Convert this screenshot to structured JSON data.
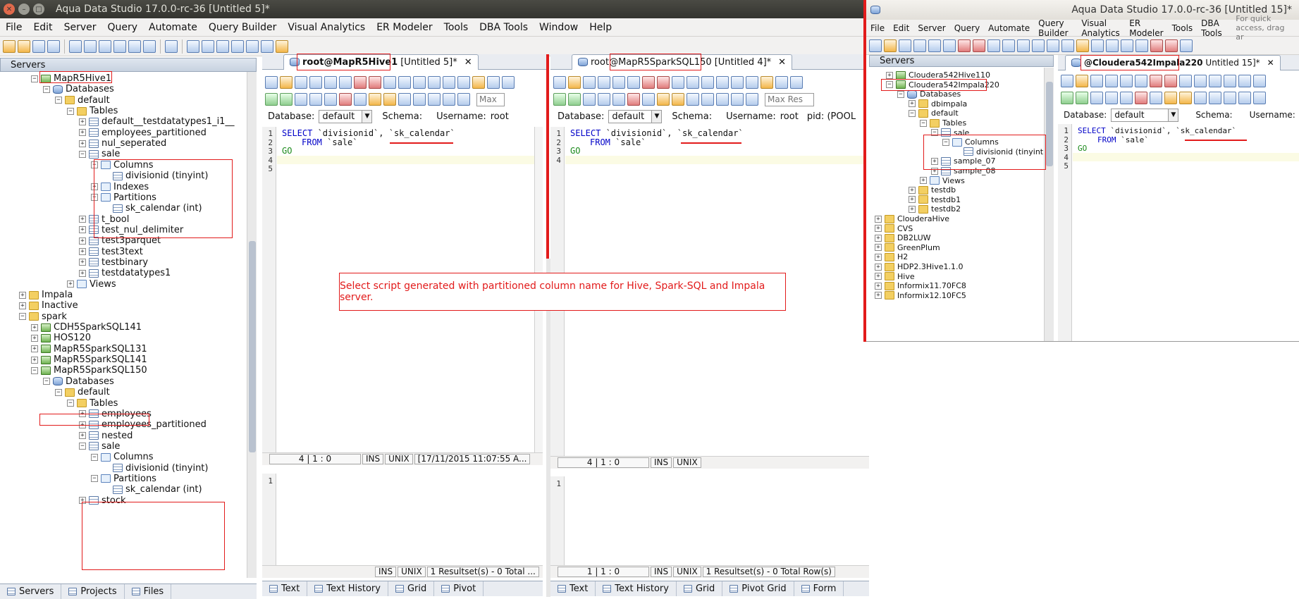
{
  "left_window": {
    "title": "Aqua Data Studio 17.0.0-rc-36 [Untitled 5]*",
    "menu": [
      "File",
      "Edit",
      "Server",
      "Query",
      "Automate",
      "Query Builder",
      "Visual Analytics",
      "ER Modeler",
      "Tools",
      "DBA Tools",
      "Window",
      "Help"
    ],
    "servers_panel_title": "Servers",
    "tree": [
      {
        "label": "MapR5Hive1",
        "icon": "server-connected",
        "level": 2,
        "exp": "-"
      },
      {
        "label": "Databases",
        "icon": "database",
        "level": 3,
        "exp": "-"
      },
      {
        "label": "default",
        "icon": "folder",
        "level": 4,
        "exp": "-"
      },
      {
        "label": "Tables",
        "icon": "folder",
        "level": 5,
        "exp": "-"
      },
      {
        "label": "default__testdatatypes1_i1__",
        "icon": "table",
        "level": 6,
        "exp": "+"
      },
      {
        "label": "employees_partitioned",
        "icon": "table",
        "level": 6,
        "exp": "+"
      },
      {
        "label": "nul_seperated",
        "icon": "table",
        "level": 6,
        "exp": "+"
      },
      {
        "label": "sale",
        "icon": "table",
        "level": 6,
        "exp": "-"
      },
      {
        "label": "Columns",
        "icon": "folder-blue",
        "level": 7,
        "exp": "-"
      },
      {
        "label": "divisionid (tinyint)",
        "icon": "table",
        "level": 8,
        "exp": ""
      },
      {
        "label": "Indexes",
        "icon": "folder-blue",
        "level": 7,
        "exp": "+"
      },
      {
        "label": "Partitions",
        "icon": "folder-blue",
        "level": 7,
        "exp": "-"
      },
      {
        "label": "sk_calendar (int)",
        "icon": "table",
        "level": 8,
        "exp": ""
      },
      {
        "label": "t_bool",
        "icon": "table",
        "level": 6,
        "exp": "+"
      },
      {
        "label": "test_nul_delimiter",
        "icon": "table",
        "level": 6,
        "exp": "+"
      },
      {
        "label": "test3parquet",
        "icon": "table",
        "level": 6,
        "exp": "+"
      },
      {
        "label": "test3text",
        "icon": "table",
        "level": 6,
        "exp": "+"
      },
      {
        "label": "testbinary",
        "icon": "table",
        "level": 6,
        "exp": "+"
      },
      {
        "label": "testdatatypes1",
        "icon": "table",
        "level": 6,
        "exp": "+"
      },
      {
        "label": "Views",
        "icon": "folder-blue",
        "level": 5,
        "exp": "+"
      },
      {
        "label": "Impala",
        "icon": "folder",
        "level": 1,
        "exp": "+"
      },
      {
        "label": "Inactive",
        "icon": "folder",
        "level": 1,
        "exp": "+"
      },
      {
        "label": "spark",
        "icon": "folder",
        "level": 1,
        "exp": "-"
      },
      {
        "label": "CDH5SparkSQL141",
        "icon": "server-connected",
        "level": 2,
        "exp": "+"
      },
      {
        "label": "HOS120",
        "icon": "server-connected",
        "level": 2,
        "exp": "+"
      },
      {
        "label": "MapR5SparkSQL131",
        "icon": "server-connected",
        "level": 2,
        "exp": "+"
      },
      {
        "label": "MapR5SparkSQL141",
        "icon": "server-connected",
        "level": 2,
        "exp": "+"
      },
      {
        "label": "MapR5SparkSQL150",
        "icon": "server-connected",
        "level": 2,
        "exp": "-"
      },
      {
        "label": "Databases",
        "icon": "database",
        "level": 3,
        "exp": "-"
      },
      {
        "label": "default",
        "icon": "folder",
        "level": 4,
        "exp": "-"
      },
      {
        "label": "Tables",
        "icon": "folder",
        "level": 5,
        "exp": "-"
      },
      {
        "label": "employees",
        "icon": "table",
        "level": 6,
        "exp": "+"
      },
      {
        "label": "employees_partitioned",
        "icon": "table",
        "level": 6,
        "exp": "+"
      },
      {
        "label": "nested",
        "icon": "table",
        "level": 6,
        "exp": "+"
      },
      {
        "label": "sale",
        "icon": "table",
        "level": 6,
        "exp": "-"
      },
      {
        "label": "Columns",
        "icon": "folder-blue",
        "level": 7,
        "exp": "-"
      },
      {
        "label": "divisionid (tinyint)",
        "icon": "table",
        "level": 8,
        "exp": ""
      },
      {
        "label": "Partitions",
        "icon": "folder-blue",
        "level": 7,
        "exp": "-"
      },
      {
        "label": "sk_calendar (int)",
        "icon": "table",
        "level": 8,
        "exp": ""
      },
      {
        "label": "stock",
        "icon": "table",
        "level": 6,
        "exp": "+"
      }
    ],
    "bottom_tabs": [
      "Servers",
      "Projects",
      "Files"
    ],
    "editor1": {
      "tab_label_user": "root@MapR5Hive1",
      "tab_label_rest": "[Untitled 5]*",
      "database_label": "Database:",
      "database_value": "default",
      "schema_label": "Schema:",
      "username_label": "Username:",
      "username_value": "root",
      "max_results_placeholder": "Max",
      "lines": [
        "1",
        "2",
        "3",
        "4",
        "5"
      ],
      "code": {
        "select_kw": "SELECT",
        "select_cols": " `divisionid`, `sk_calendar`",
        "from_kw": "FROM",
        "from_tbl": " `sale`",
        "go": "GO"
      },
      "status": {
        "pos": "4 | 1 : 0",
        "ins": "INS",
        "unix": "UNIX",
        "time": "[17/11/2015 11:07:55 A..."
      },
      "result_line": "1",
      "result_status": {
        "ins": "INS",
        "unix": "UNIX",
        "msg": "1 Resultset(s) - 0 Total ..."
      },
      "bottom_tabs": [
        "Text",
        "Text History",
        "Grid",
        "Pivot"
      ]
    },
    "editor2": {
      "tab_label_user": "root@MapR5SparkSQL150",
      "tab_label_rest": "[Untitled 4]*",
      "database_label": "Database:",
      "database_value": "default",
      "schema_label": "Schema:",
      "username_label": "Username:",
      "username_value": "root",
      "pid_label": "pid: (POOL",
      "max_results_placeholder": "Max Res",
      "lines": [
        "1",
        "2",
        "3",
        "4"
      ],
      "code": {
        "select_kw": "SELECT",
        "select_cols": " `divisionid`, `sk_calendar`",
        "from_kw": "FROM",
        "from_tbl": " `sale`",
        "go": "GO"
      },
      "status": {
        "pos": "4 | 1 : 0",
        "ins": "INS",
        "unix": "UNIX"
      },
      "result_line": "1",
      "result_status": {
        "pos": "1 | 1 : 0",
        "ins": "INS",
        "unix": "UNIX",
        "msg": "1 Resultset(s) - 0 Total Row(s)"
      },
      "bottom_tabs": [
        "Text",
        "Text History",
        "Grid",
        "Pivot Grid",
        "Form"
      ]
    }
  },
  "right_window": {
    "title": "Aqua Data Studio 17.0.0-rc-36 [Untitled 15]*",
    "menu": [
      "File",
      "Edit",
      "Server",
      "Query",
      "Automate",
      "Query Builder",
      "Visual Analytics",
      "ER Modeler",
      "Tools",
      "DBA Tools"
    ],
    "quick_access": "For quick access, drag ar",
    "servers_panel_title": "Servers",
    "tree": [
      {
        "label": "Cloudera542Hive110",
        "icon": "server-connected",
        "level": 1,
        "exp": "+"
      },
      {
        "label": "Cloudera542Impala220",
        "icon": "server-connected",
        "level": 1,
        "exp": "-"
      },
      {
        "label": "Databases",
        "icon": "database",
        "level": 2,
        "exp": "-"
      },
      {
        "label": "dbimpala",
        "icon": "folder",
        "level": 3,
        "exp": "+"
      },
      {
        "label": "default",
        "icon": "folder",
        "level": 3,
        "exp": "-"
      },
      {
        "label": "Tables",
        "icon": "folder",
        "level": 4,
        "exp": "-"
      },
      {
        "label": "sale",
        "icon": "table",
        "level": 5,
        "exp": "-"
      },
      {
        "label": "Columns",
        "icon": "folder-blue",
        "level": 6,
        "exp": "-"
      },
      {
        "label": "divisionid (tinyint)",
        "icon": "table",
        "level": 7,
        "exp": ""
      },
      {
        "label": "sample_07",
        "icon": "table",
        "level": 5,
        "exp": "+"
      },
      {
        "label": "sample_08",
        "icon": "table",
        "level": 5,
        "exp": "+"
      },
      {
        "label": "Views",
        "icon": "folder-blue",
        "level": 4,
        "exp": "+"
      },
      {
        "label": "testdb",
        "icon": "folder",
        "level": 3,
        "exp": "+"
      },
      {
        "label": "testdb1",
        "icon": "folder",
        "level": 3,
        "exp": "+"
      },
      {
        "label": "testdb2",
        "icon": "folder",
        "level": 3,
        "exp": "+"
      },
      {
        "label": "ClouderaHive",
        "icon": "folder",
        "level": 0,
        "exp": "+"
      },
      {
        "label": "CVS",
        "icon": "folder",
        "level": 0,
        "exp": "+"
      },
      {
        "label": "DB2LUW",
        "icon": "folder",
        "level": 0,
        "exp": "+"
      },
      {
        "label": "GreenPlum",
        "icon": "folder",
        "level": 0,
        "exp": "+"
      },
      {
        "label": "H2",
        "icon": "folder",
        "level": 0,
        "exp": "+"
      },
      {
        "label": "HDP2.3Hive1.1.0",
        "icon": "folder",
        "level": 0,
        "exp": "+"
      },
      {
        "label": "Hive",
        "icon": "folder",
        "level": 0,
        "exp": "+"
      },
      {
        "label": "Informix11.70FC8",
        "icon": "folder",
        "level": 0,
        "exp": "+"
      },
      {
        "label": "Informix12.10FC5",
        "icon": "folder",
        "level": 0,
        "exp": "+"
      }
    ],
    "editor": {
      "tab_label_user": "@Cloudera542Impala220",
      "tab_label_rest": "Untitled 15]*",
      "database_label": "Database:",
      "database_value": "default",
      "schema_label": "Schema:",
      "username_label": "Username:",
      "lines": [
        "1",
        "2",
        "3",
        "4",
        "5"
      ],
      "code": {
        "select_kw": "SELECT",
        "select_cols": " `divisionid`, `sk_calendar`",
        "from_kw": "FROM",
        "from_tbl": " `sale`",
        "go": "GO"
      }
    }
  },
  "callout": "Select script generated with partitioned column name for Hive, Spark-SQL and Impala server.",
  "colors": {
    "highlight": "#e21b1b",
    "keyword": "#0000c8",
    "go": "#1b8a1b"
  }
}
